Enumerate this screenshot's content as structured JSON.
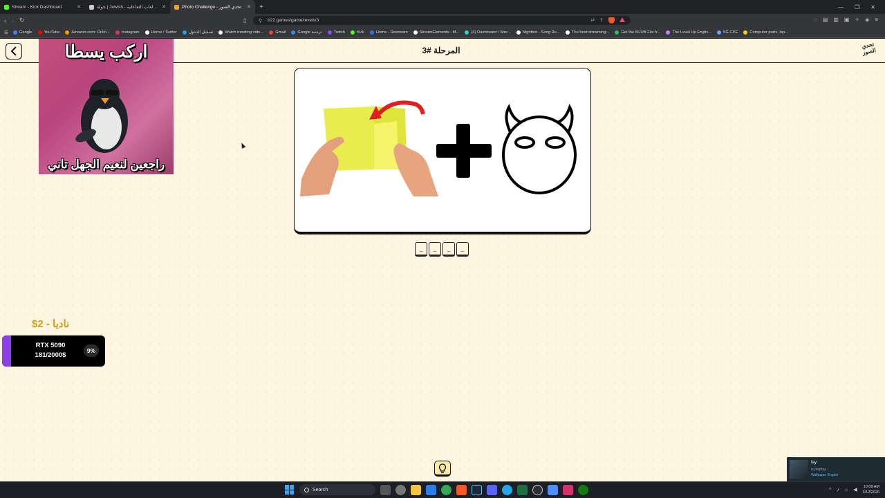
{
  "browser": {
    "tabs": [
      {
        "title": "Stream - Kick Dashboard",
        "active": false,
        "color": "#53fc18"
      },
      {
        "title": "جولة | Jewish - منصة الألعاب التفاعلية",
        "active": false,
        "color": "#cccccc"
      },
      {
        "title": "Photo Challenge - تحدي الصور",
        "active": true,
        "color": "#f0a030"
      }
    ],
    "url": "b22.games/game/levels/3",
    "bookmarks": [
      {
        "label": "Google",
        "color": "#4285f4"
      },
      {
        "label": "YouTube",
        "color": "#ff0000"
      },
      {
        "label": "Amazon.com: Onlin...",
        "color": "#ff9900"
      },
      {
        "label": "Instagram",
        "color": "#e1306c"
      },
      {
        "label": "Home / Twitter",
        "color": "#ffffff"
      },
      {
        "label": "تسجيل الدخول",
        "color": "#1da1f2"
      },
      {
        "label": "Watch trending vide...",
        "color": "#ffffff"
      },
      {
        "label": "Gmail",
        "color": "#ea4335"
      },
      {
        "label": "Google ترجمة",
        "color": "#4285f4"
      },
      {
        "label": "Twitch",
        "color": "#9146ff"
      },
      {
        "label": "Kick",
        "color": "#53fc18"
      },
      {
        "label": "Home - Restream",
        "color": "#3a6df0"
      },
      {
        "label": "StreamElements - M...",
        "color": "#ffffff"
      },
      {
        "label": "(4) Dashboard / Stre...",
        "color": "#2dd4bf"
      },
      {
        "label": "Nightbot - Song Re...",
        "color": "#ffffff"
      },
      {
        "label": "The best streaming...",
        "color": "#ffffff"
      },
      {
        "label": "Get the MJUB File fr...",
        "color": "#22c55e"
      },
      {
        "label": "The Level Up Englis...",
        "color": "#c084fc"
      },
      {
        "label": "5G CPE",
        "color": "#60a5fa"
      },
      {
        "label": "Computer parts, lap...",
        "color": "#facc15"
      }
    ]
  },
  "page": {
    "level_title": "المرحلة #3",
    "logo_text": "تحدي الصور",
    "meme_top": "اركب يسطا",
    "meme_bottom": "راجعين لنعيم الجهل تاني",
    "answer_slots": [
      "_",
      "_",
      "_",
      "_"
    ],
    "donor": "ناديا - 2$",
    "goal": {
      "item": "RTX 5090",
      "amount": "181/2000$",
      "percent_label": "9%",
      "progress": 0.09,
      "bar_color": "#8c3ee8"
    },
    "hint_icon": "lightbulb-icon"
  },
  "overlay": {
    "user": "fay",
    "status": "is playing",
    "app": "Wallpaper Engine"
  },
  "taskbar": {
    "search_label": "Search",
    "time": "10:08 AM",
    "date": "3/12/2026"
  }
}
